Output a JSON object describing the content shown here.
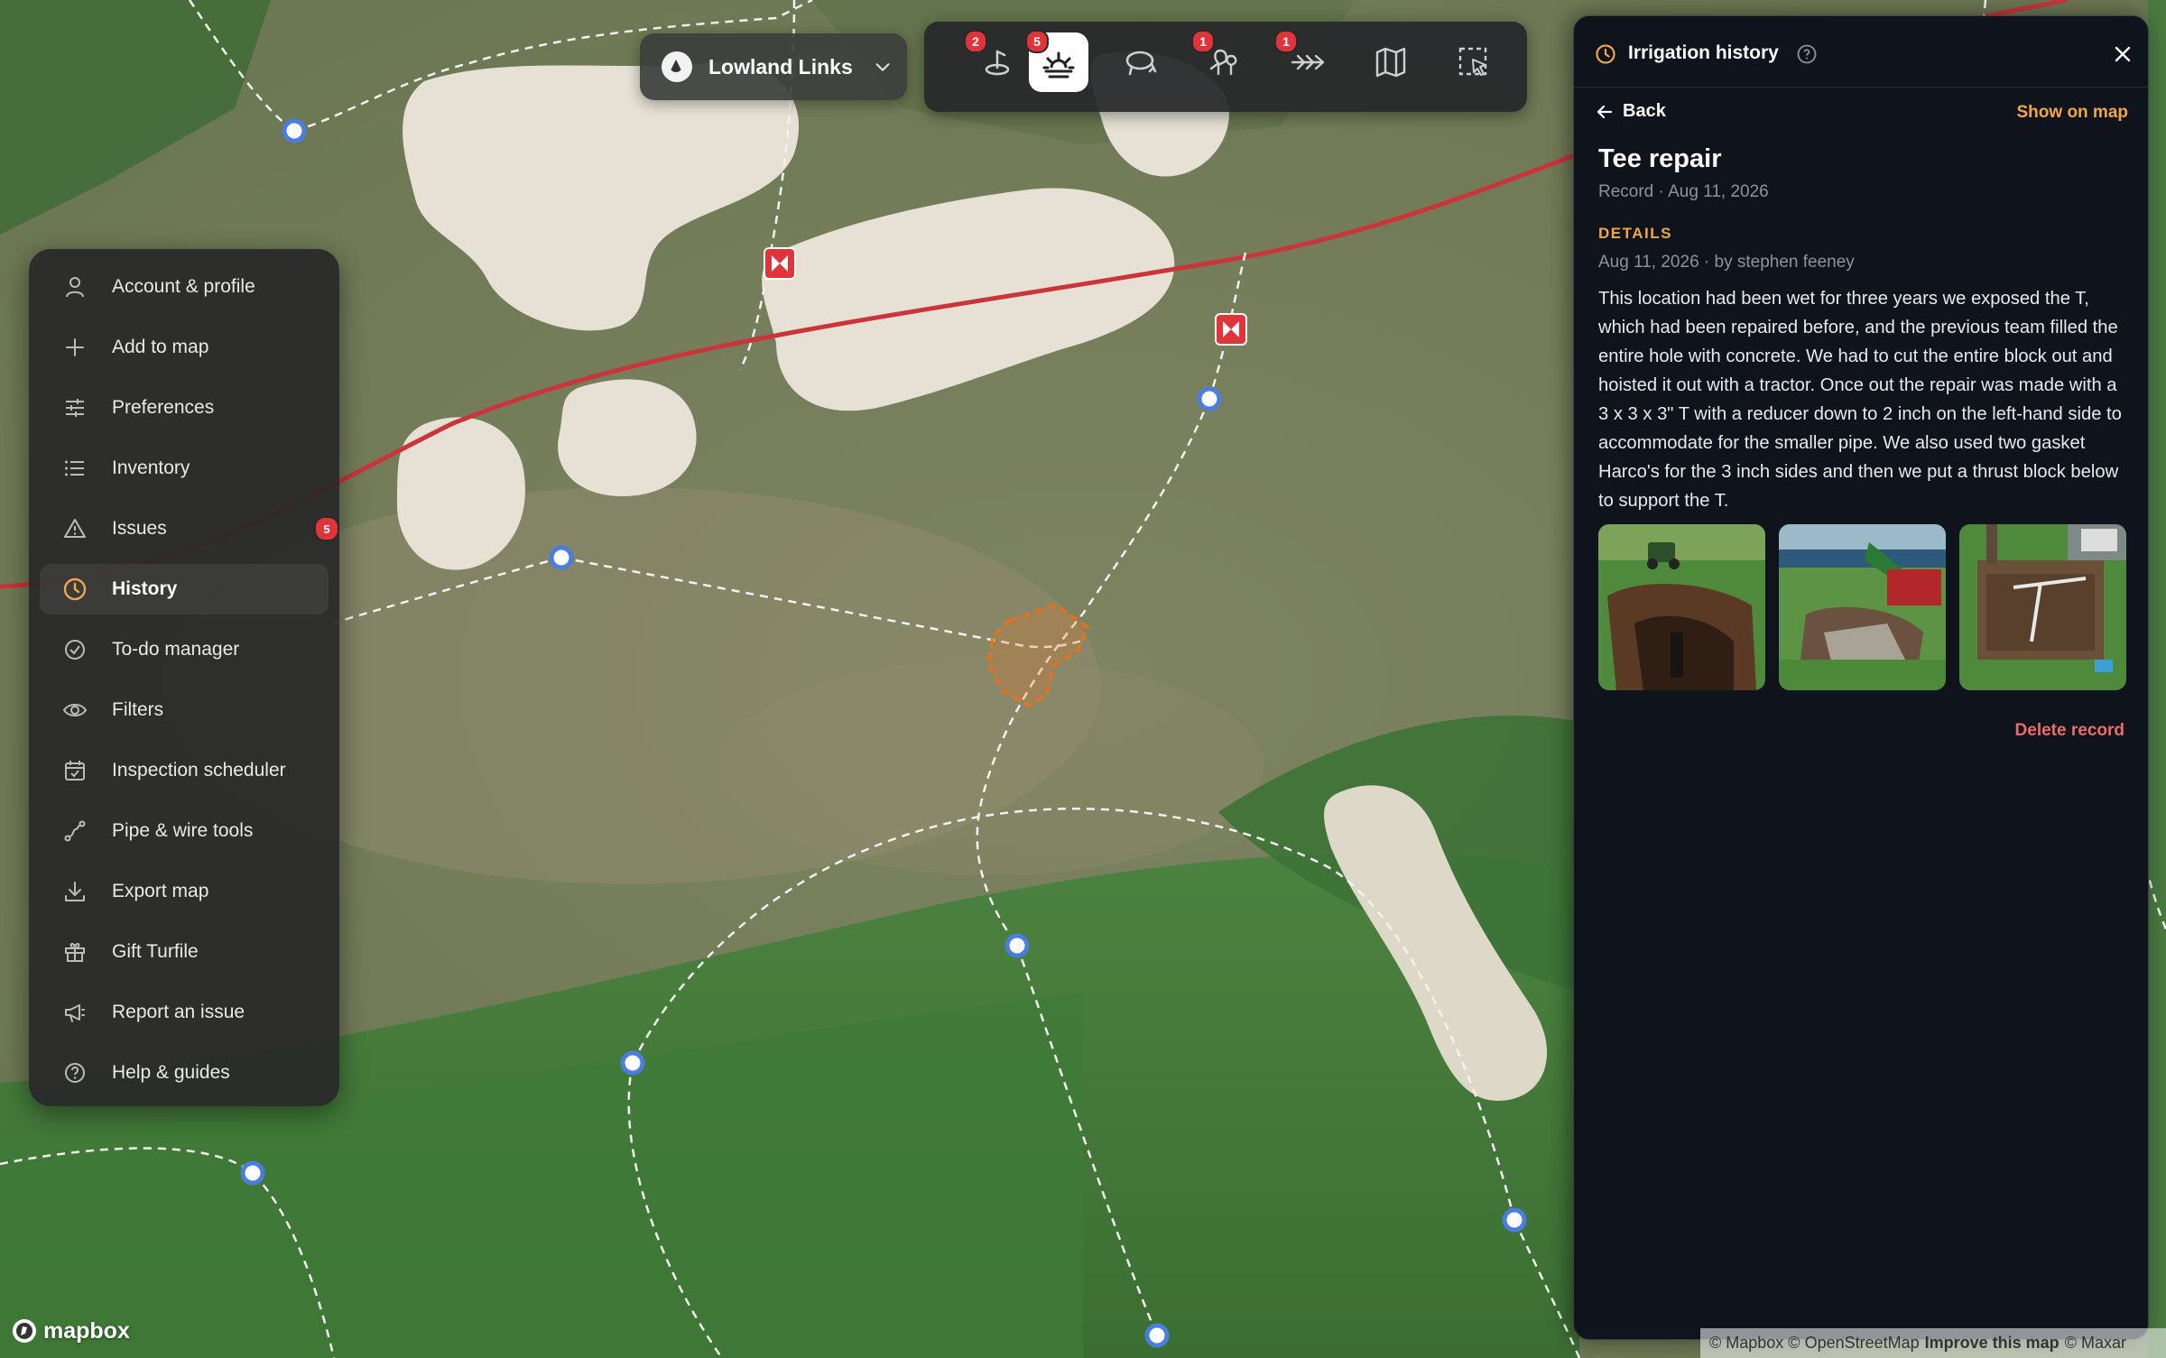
{
  "course": {
    "name": "Lowland Links"
  },
  "toolbar": {
    "buttons": [
      {
        "icon": "sprinkler-head-icon",
        "badge": "2"
      },
      {
        "icon": "sunrise-inspection-icon",
        "badge": "5",
        "active": true
      },
      {
        "icon": "lasso-area-icon",
        "badge": ""
      },
      {
        "icon": "trees-icon",
        "badge": "1"
      },
      {
        "icon": "arrows-flow-icon",
        "badge": "1"
      },
      {
        "icon": "map-layers-icon",
        "badge": ""
      },
      {
        "icon": "select-area-icon",
        "badge": ""
      }
    ]
  },
  "sidebar": {
    "items": [
      {
        "label": "Account & profile",
        "icon": "user-icon"
      },
      {
        "label": "Add to map",
        "icon": "plus-icon"
      },
      {
        "label": "Preferences",
        "icon": "sliders-icon"
      },
      {
        "label": "Inventory",
        "icon": "list-icon"
      },
      {
        "label": "Issues",
        "icon": "warning-icon",
        "badge": "5"
      },
      {
        "label": "History",
        "icon": "clock-icon",
        "active": true
      },
      {
        "label": "To-do manager",
        "icon": "check-circle-icon"
      },
      {
        "label": "Filters",
        "icon": "eye-icon"
      },
      {
        "label": "Inspection scheduler",
        "icon": "calendar-icon"
      },
      {
        "label": "Pipe & wire tools",
        "icon": "pipe-tool-icon"
      },
      {
        "label": "Export map",
        "icon": "download-icon"
      },
      {
        "label": "Gift Turfile",
        "icon": "gift-icon"
      },
      {
        "label": "Report an issue",
        "icon": "megaphone-icon"
      },
      {
        "label": "Help & guides",
        "icon": "help-circle-icon"
      }
    ]
  },
  "panel": {
    "title": "Irrigation history",
    "back_label": "Back",
    "show_on_map": "Show on map",
    "record_title": "Tee repair",
    "record_sub": "Record · Aug 11, 2026",
    "details_label": "DETAILS",
    "meta": "Aug 11, 2026 · by stephen feeney",
    "description": "This location had been wet for three years we exposed the T, which had been repaired before, and the previous team filled the entire hole with concrete. We had to cut the entire block out and hoisted it out with a tractor. Once out the repair was made with a 3 x 3 x 3\" T with a reducer down to 2 inch on the left-hand side to accommodate for the smaller pipe. We also used two gasket Harco's for the 3 inch sides and then we put a thrust block below to support the T.",
    "photo_count": 3,
    "delete_label": "Delete record",
    "accent_color": "#f0a64a",
    "danger_color": "#ee6b6b"
  },
  "map": {
    "attribution": {
      "part1": "© Mapbox © OpenStreetMap",
      "link": "Improve this map",
      "part2": "© Maxar"
    },
    "brand": "mapbox",
    "pipe_color": "#c9353a"
  }
}
